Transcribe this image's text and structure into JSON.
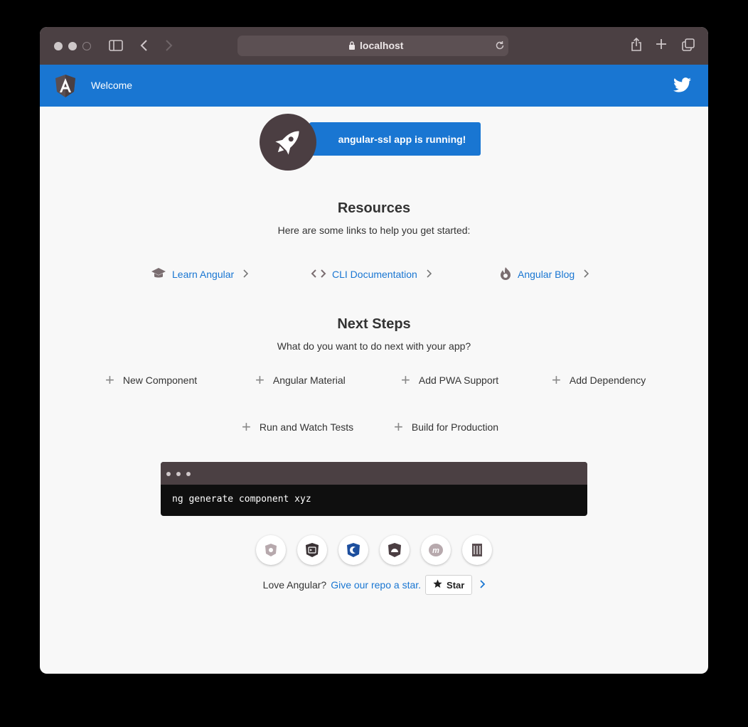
{
  "browser": {
    "url": "localhost",
    "icons": {
      "sidebar": "sidebar-icon",
      "back": "back-icon",
      "forward": "forward-icon",
      "lock": "lock-icon",
      "reload": "reload-icon",
      "share": "share-icon",
      "new_tab": "plus-icon",
      "tabs": "tabs-icon"
    }
  },
  "toolbar": {
    "title": "Welcome",
    "logo": "angular-logo-icon",
    "twitter": "twitter-icon",
    "color": "#1976d2"
  },
  "hero": {
    "banner": "angular-ssl app is running!",
    "icon": "rocket-icon"
  },
  "resources": {
    "heading": "Resources",
    "subtitle": "Here are some links to help you get started:",
    "links": [
      {
        "label": "Learn Angular",
        "icon": "graduation-cap-icon"
      },
      {
        "label": "CLI Documentation",
        "icon": "code-icon"
      },
      {
        "label": "Angular Blog",
        "icon": "flame-icon"
      }
    ]
  },
  "next_steps": {
    "heading": "Next Steps",
    "subtitle": "What do you want to do next with your app?",
    "items": [
      "New Component",
      "Angular Material",
      "Add PWA Support",
      "Add Dependency",
      "Run and Watch Tests",
      "Build for Production"
    ]
  },
  "terminal": {
    "command": "ng generate component xyz"
  },
  "badges": [
    "animations-icon",
    "cli-icon",
    "augury-icon",
    "protractor-icon",
    "meetup-icon",
    "discord-icon"
  ],
  "footer": {
    "text": "Love Angular?",
    "link": "Give our repo a star.",
    "star_label": "Star"
  }
}
